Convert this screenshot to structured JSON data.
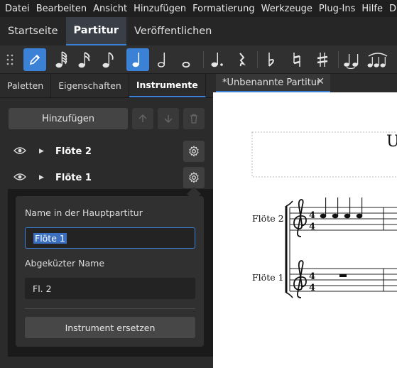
{
  "menubar": {
    "items": [
      "Datei",
      "Bearbeiten",
      "Ansicht",
      "Hinzufügen",
      "Formatierung",
      "Werkzeuge",
      "Plug-Ins",
      "Hilfe",
      "Diag"
    ]
  },
  "workspace_tabs": [
    {
      "label": "Startseite",
      "active": false
    },
    {
      "label": "Partitur",
      "active": true
    },
    {
      "label": "Veröffentlichen",
      "active": false
    }
  ],
  "note_input_toolbar": {
    "tools": [
      {
        "name": "grip-handle-icon"
      },
      {
        "name": "note-input-pen-icon",
        "active": true
      },
      {
        "name": "64th-note-icon"
      },
      {
        "name": "32nd-note-icon"
      },
      {
        "name": "16th-note-icon"
      },
      {
        "name": "eighth-note-icon"
      },
      {
        "name": "quarter-note-icon",
        "active": true
      },
      {
        "name": "half-note-icon"
      },
      {
        "name": "whole-note-icon"
      },
      {
        "name": "augmentation-dot-icon"
      },
      {
        "name": "rest-icon"
      },
      {
        "name": "flat-icon"
      },
      {
        "name": "natural-icon"
      },
      {
        "name": "sharp-icon"
      },
      {
        "name": "tie-icon"
      },
      {
        "name": "slur-icon"
      }
    ]
  },
  "panel_tabs": [
    {
      "label": "Paletten",
      "active": false
    },
    {
      "label": "Eigenschaften",
      "active": false
    },
    {
      "label": "Instrumente",
      "active": true
    }
  ],
  "panel_more": "⋯",
  "instruments_panel": {
    "add_label": "Hinzufügen",
    "instruments": [
      {
        "name": "Flöte 2"
      },
      {
        "name": "Flöte 1"
      }
    ]
  },
  "instrument_settings_popup": {
    "full_name_label": "Name in der Hauptpartitur",
    "full_name_value": "Flöte 1",
    "short_name_label": "Abgeküzter Name",
    "short_name_value": "Fl. 2",
    "replace_label": "Instrument ersetzen"
  },
  "score_tab": {
    "title": "*Unbenannte Partitur",
    "close": "✕"
  },
  "score": {
    "title_partial": "U",
    "staves": [
      {
        "label": "Flöte 2",
        "time_signature": "4/4",
        "content": "4 quarter notes"
      },
      {
        "label": "Flöte 1",
        "time_signature": "4/4",
        "content": "whole rest"
      }
    ]
  },
  "colors": {
    "accent": "#3b82d6",
    "background": "#2b2b2b",
    "menubar": "#1f1f1f",
    "score_paper": "#ffffff"
  }
}
